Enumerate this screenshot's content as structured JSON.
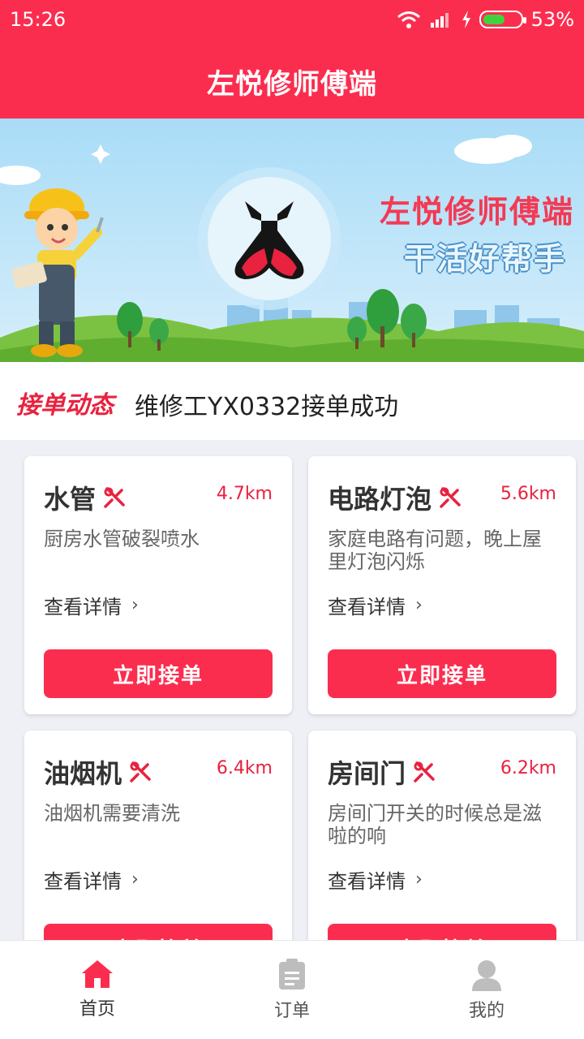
{
  "status_bar": {
    "time": "15:26",
    "battery": "53%"
  },
  "header": {
    "title": "左悦修师傅端"
  },
  "banner": {
    "title": "左悦修师傅端",
    "subtitle": "干活好帮手"
  },
  "ticker": {
    "tag": "接单动态",
    "message": "维修工YX0332接单成功"
  },
  "cards": [
    {
      "name": "水管",
      "distance": "4.7km",
      "desc": "厨房水管破裂喷水",
      "detail": "查看详情",
      "button": "立即接单"
    },
    {
      "name": "电路灯泡",
      "distance": "5.6km",
      "desc": "家庭电路有问题，晚上屋里灯泡闪烁",
      "detail": "查看详情",
      "button": "立即接单"
    },
    {
      "name": "油烟机",
      "distance": "6.4km",
      "desc": "油烟机需要清洗",
      "detail": "查看详情",
      "button": "立即接单"
    },
    {
      "name": "房间门",
      "distance": "6.2km",
      "desc": "房间门开关的时候总是滋啦的响",
      "detail": "查看详情",
      "button": "立即接单"
    }
  ],
  "nav": [
    {
      "label": "首页",
      "icon": "home-icon",
      "active": true
    },
    {
      "label": "订单",
      "icon": "clipboard-icon",
      "active": false
    },
    {
      "label": "我的",
      "icon": "user-icon",
      "active": false
    }
  ],
  "colors": {
    "accent": "#fb2d4f",
    "inactive_icon": "#bdbdbd"
  }
}
